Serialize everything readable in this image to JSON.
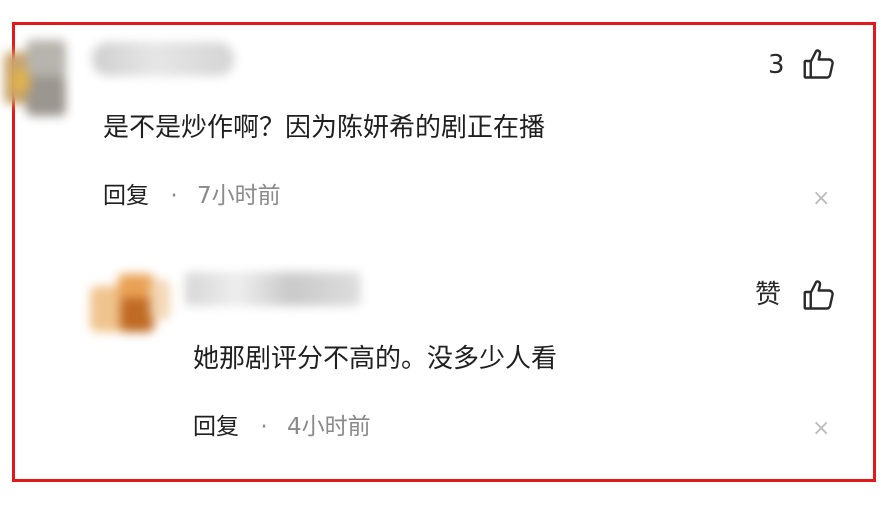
{
  "comments": [
    {
      "text": "是不是炒作啊？因为陈妍希的剧正在播",
      "reply_label": "回复",
      "separator": "·",
      "time": "7小时前",
      "like_count": "3",
      "close_glyph": "×"
    },
    {
      "text": "她那剧评分不高的。没多少人看",
      "reply_label": "回复",
      "separator": "·",
      "time": "4小时前",
      "like_label": "赞",
      "close_glyph": "×"
    }
  ],
  "colors": {
    "highlight_border": "#e2191b",
    "meta_text": "#8a8a8a"
  },
  "icons": [
    "thumbs-up-icon",
    "close-icon"
  ]
}
